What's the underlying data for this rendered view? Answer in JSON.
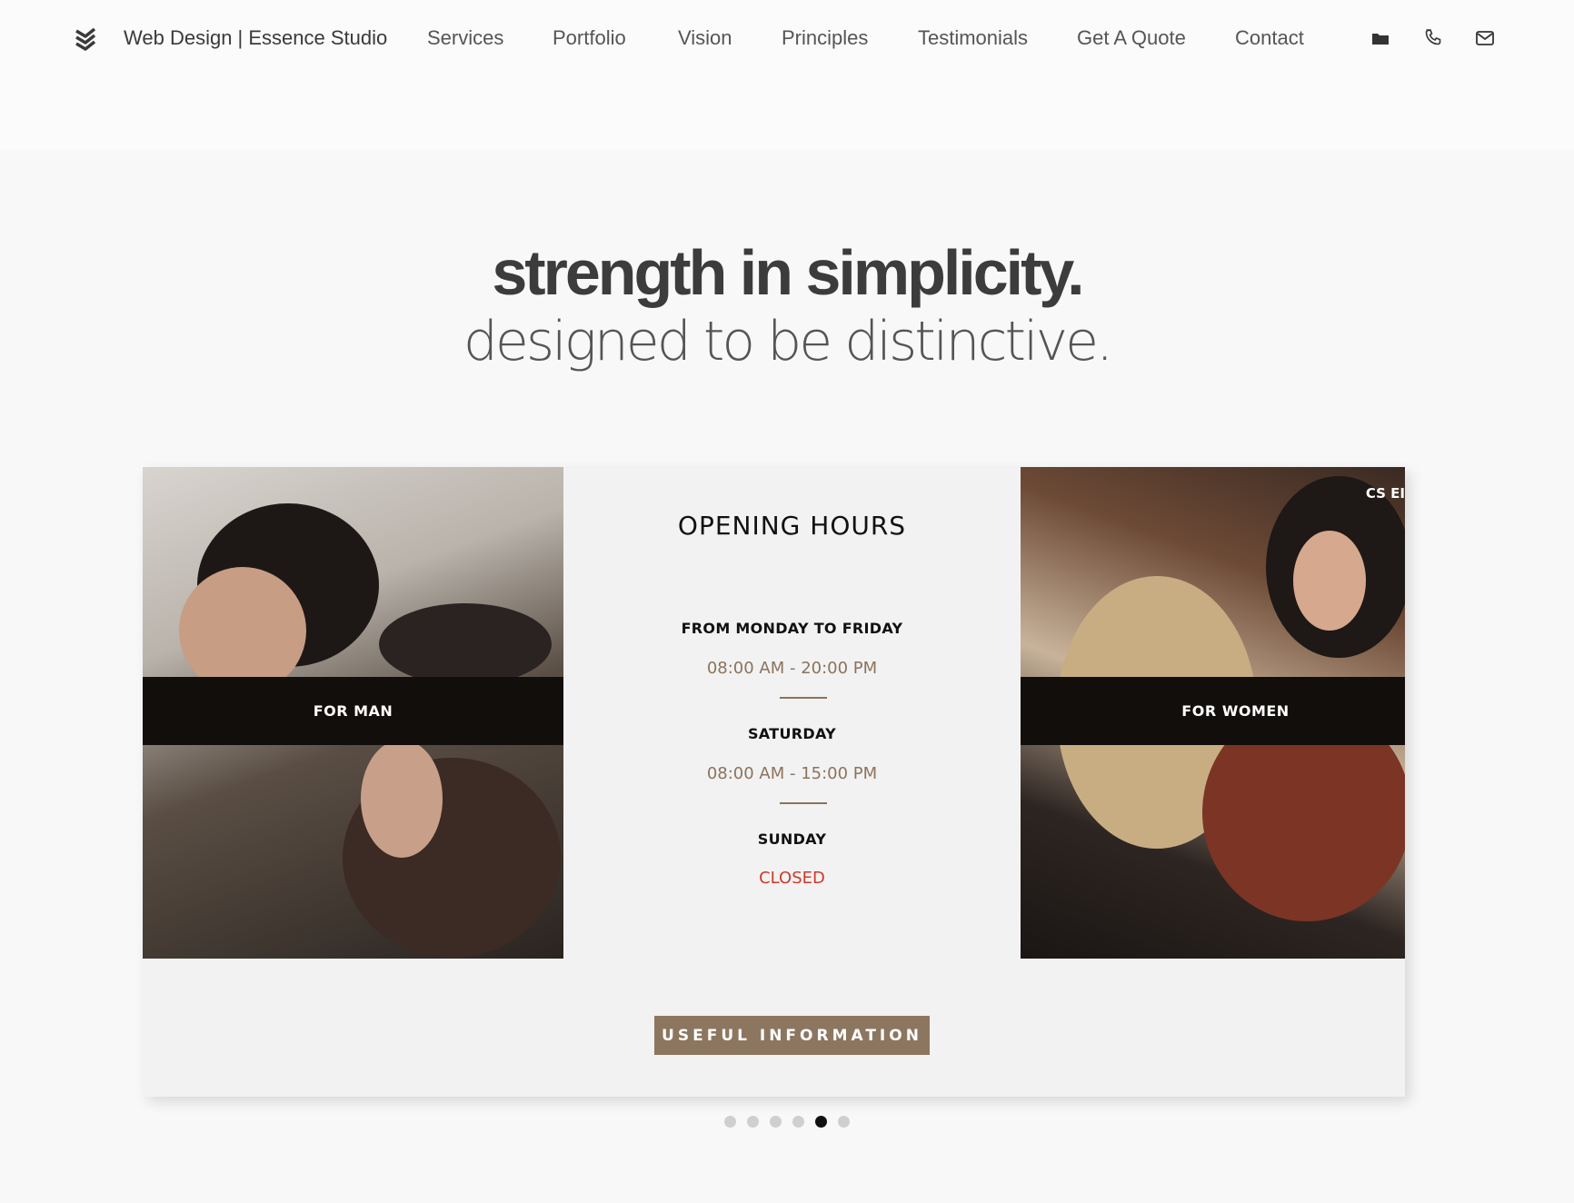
{
  "header": {
    "brand": "Web Design | Essence Studio",
    "nav": [
      "Services",
      "Portfolio",
      "Vision",
      "Principles",
      "Testimonials",
      "Get A Quote",
      "Contact"
    ],
    "icons": [
      "folder-icon",
      "phone-icon",
      "mail-icon"
    ]
  },
  "hero": {
    "title": "strength in simplicity.",
    "subtitle": "designed to be distinctive."
  },
  "card": {
    "left_label": "FOR MAN",
    "right_label": "FOR WOMEN",
    "right_badge": "CS EI",
    "hours_title": "OPENING HOURS",
    "schedule": [
      {
        "day": "FROM MONDAY TO FRIDAY",
        "time": "08:00 AM - 20:00 PM"
      },
      {
        "day": "SATURDAY",
        "time": "08:00 AM - 15:00 PM"
      },
      {
        "day": "SUNDAY",
        "time": "CLOSED"
      }
    ],
    "button": "USEFUL INFORMATION"
  },
  "carousel": {
    "total": 6,
    "active": 5
  },
  "colors": {
    "accent": "#8d7660",
    "closed": "#d0382b",
    "band": "#120e0c"
  }
}
